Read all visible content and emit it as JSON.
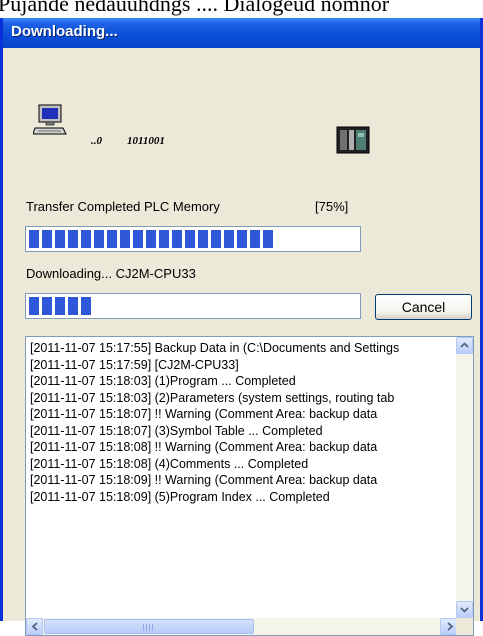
{
  "caption": "Půjände nedauuhdngs .... Dialogeud nomnor",
  "window": {
    "title": "Downloading..."
  },
  "transfer_visual": {
    "bits_prefix": "..0",
    "bits": "1011001",
    "pc_icon": "computer-icon",
    "plc_icon": "plc-device-icon"
  },
  "transfer": {
    "label": "Transfer Completed PLC Memory",
    "percent_text": "[75%]",
    "progress": 0.75
  },
  "download": {
    "label": "Downloading... CJ2M-CPU33",
    "progress": 0.18
  },
  "cancel_label": "Cancel",
  "log": {
    "lines": [
      "[2011-11-07 15:17:55] Backup Data in (C:\\Documents and Settings",
      "[2011-11-07 15:17:59] [CJ2M-CPU33]",
      "[2011-11-07 15:18:03]   (1)Program   ... Completed",
      "[2011-11-07 15:18:03]   (2)Parameters (system settings, routing tab",
      "[2011-11-07 15:18:07]      !! Warning (Comment Area: backup data",
      "[2011-11-07 15:18:07]   (3)Symbol Table   ... Completed",
      "[2011-11-07 15:18:08]      !! Warning (Comment Area: backup data",
      "[2011-11-07 15:18:08]   (4)Comments   ... Completed",
      "[2011-11-07 15:18:09]      !! Warning (Comment Area: backup data",
      "[2011-11-07 15:18:09]   (5)Program Index   ... Completed"
    ]
  },
  "colors": {
    "titlebar": "#0A50DA",
    "progress_fill": "#2F58D8",
    "dialog_bg": "#ECE9D8"
  }
}
